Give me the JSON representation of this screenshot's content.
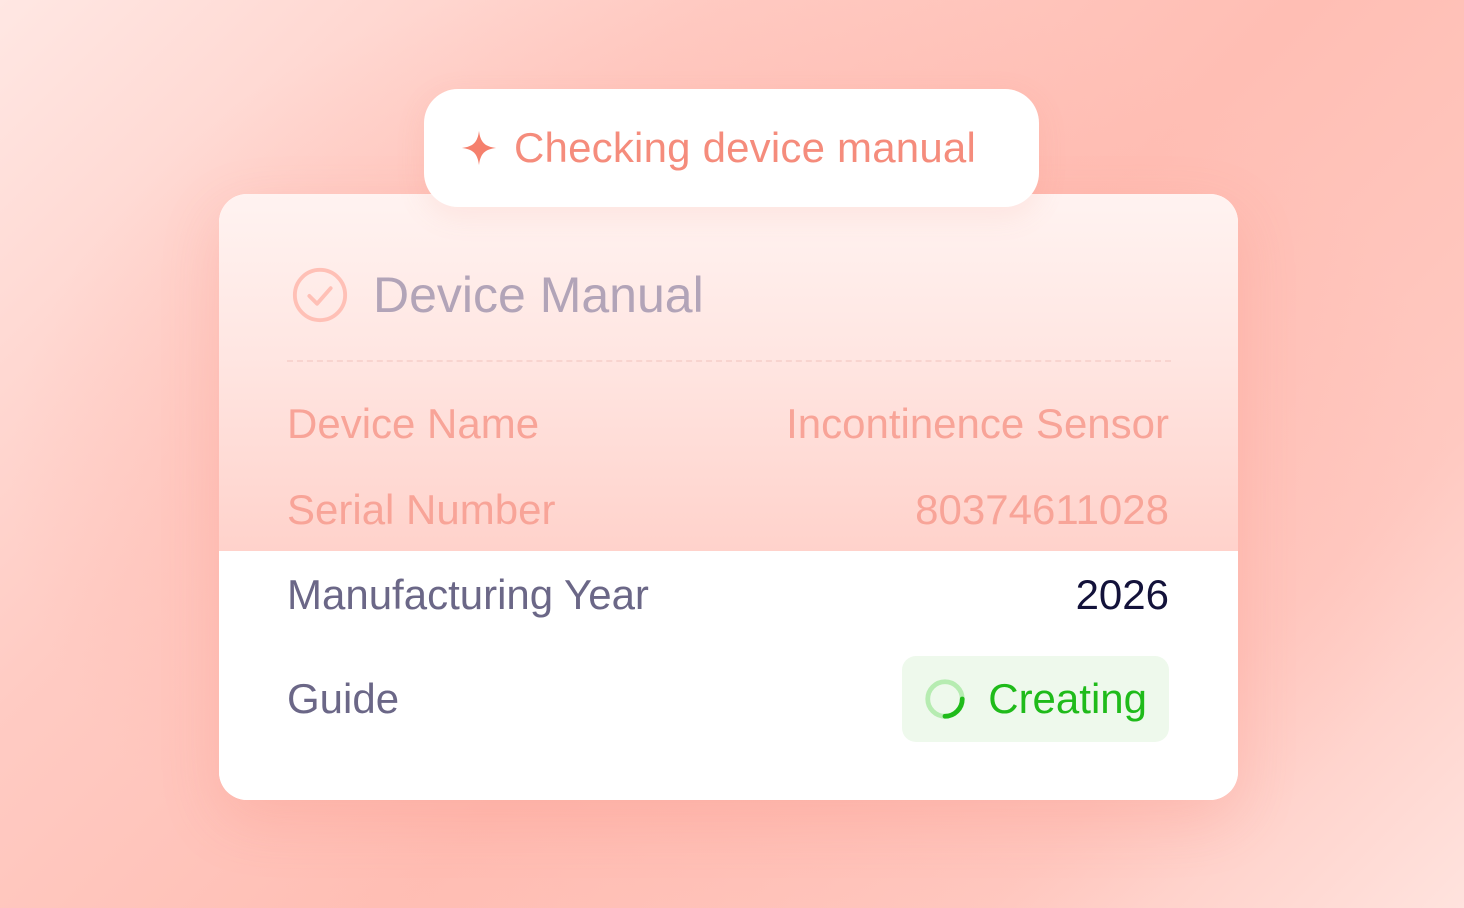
{
  "status_pill": {
    "icon": "sparkle-icon",
    "label": "Checking device manual"
  },
  "card": {
    "title": "Device Manual",
    "title_icon": "check-circle-icon",
    "rows": [
      {
        "label": "Device Name",
        "value": "Incontinence Sensor"
      },
      {
        "label": "Serial Number",
        "value": "80374611028"
      },
      {
        "label": "Manufacturing Year",
        "value": "2026"
      },
      {
        "label": "Guide",
        "value": "Creating",
        "icon": "loading-spinner-icon"
      }
    ]
  },
  "colors": {
    "accent": "#f58c7c",
    "success": "#1fbb1a",
    "success_bg": "#eef9ec",
    "label": "#6b6787",
    "value": "#13123a"
  }
}
